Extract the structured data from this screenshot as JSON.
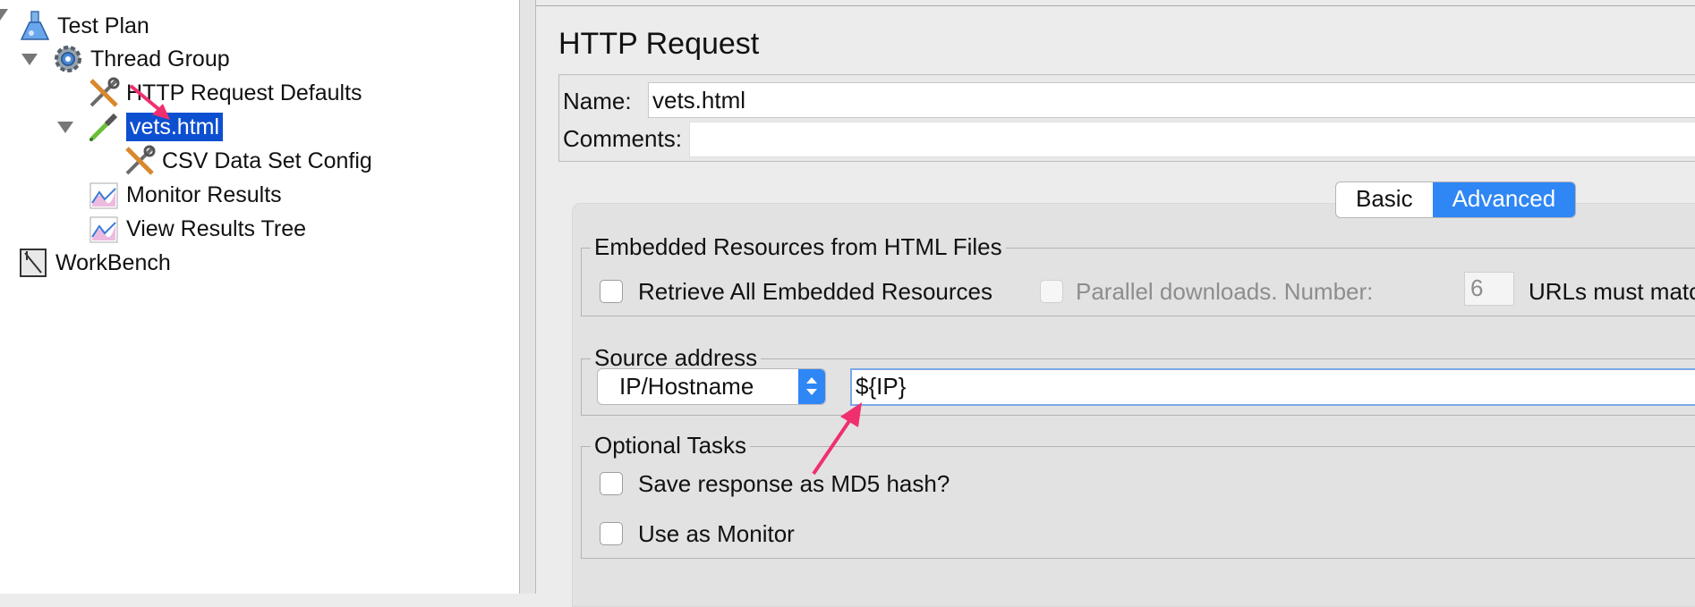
{
  "tree": {
    "items": [
      {
        "label": "Test Plan",
        "icon": "flask-icon"
      },
      {
        "label": "Thread Group",
        "icon": "gear-icon"
      },
      {
        "label": "HTTP Request Defaults",
        "icon": "tools-icon"
      },
      {
        "label": "vets.html",
        "icon": "pipette-icon"
      },
      {
        "label": "CSV Data Set Config",
        "icon": "tools-icon"
      },
      {
        "label": "Monitor Results",
        "icon": "graph-icon"
      },
      {
        "label": "View Results Tree",
        "icon": "graph-icon"
      },
      {
        "label": "WorkBench",
        "icon": "workbench-icon"
      }
    ],
    "selected": "vets.html"
  },
  "panel": {
    "title": "HTTP Request",
    "name_label": "Name:",
    "name_value": "vets.html",
    "comments_label": "Comments:",
    "comments_value": ""
  },
  "tabs": [
    {
      "label": "Basic",
      "active": false
    },
    {
      "label": "Advanced",
      "active": true
    }
  ],
  "embedded": {
    "title": "Embedded Resources from HTML Files",
    "retrieve_label": "Retrieve All Embedded Resources",
    "parallel_label": "Parallel downloads. Number:",
    "parallel_value": "6",
    "urls_label": "URLs must match:"
  },
  "source": {
    "title": "Source address",
    "type_value": "IP/Hostname",
    "address_value": "${IP}"
  },
  "optional": {
    "title": "Optional Tasks",
    "md5_label": "Save response as MD5 hash?",
    "monitor_label": "Use as Monitor"
  },
  "colors": {
    "selection": "#0d4fd1",
    "accent": "#2f86f5",
    "annotation_arrow": "#f0306e"
  }
}
